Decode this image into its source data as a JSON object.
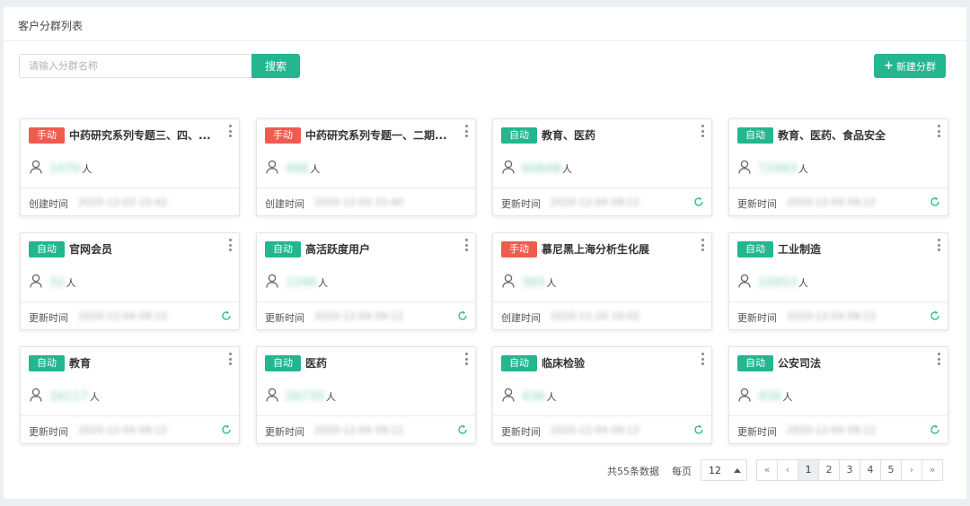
{
  "header": {
    "title": "客户分群列表"
  },
  "search": {
    "placeholder": "请输入分群名称",
    "button_label": "搜索"
  },
  "actions": {
    "new_label": "新建分群"
  },
  "cards": [
    {
      "badge": "手动",
      "badge_type": "manual",
      "title": "中药研究系列专题三、四、...",
      "count": "1070",
      "unit": "人",
      "time_label": "创建时间",
      "time_value": "2020-12-03 15:42",
      "refresh": false
    },
    {
      "badge": "手动",
      "badge_type": "manual",
      "title": "中药研究系列专题一、二期...",
      "count": "486",
      "unit": "人",
      "time_label": "创建时间",
      "time_value": "2020-12-03 15:40",
      "refresh": false
    },
    {
      "badge": "自动",
      "badge_type": "auto",
      "title": "教育、医药",
      "count": "60848",
      "unit": "人",
      "time_label": "更新时间",
      "time_value": "2020-12-04 09:12",
      "refresh": true
    },
    {
      "badge": "自动",
      "badge_type": "auto",
      "title": "教育、医药、食品安全",
      "count": "72063",
      "unit": "人",
      "time_label": "更新时间",
      "time_value": "2020-12-04 09:12",
      "refresh": true
    },
    {
      "badge": "自动",
      "badge_type": "auto",
      "title": "官网会员",
      "count": "32",
      "unit": "人",
      "time_label": "更新时间",
      "time_value": "2020-12-04 09:12",
      "refresh": true
    },
    {
      "badge": "自动",
      "badge_type": "auto",
      "title": "高活跃度用户",
      "count": "1246",
      "unit": "人",
      "time_label": "更新时间",
      "time_value": "2020-12-04 09:12",
      "refresh": true
    },
    {
      "badge": "手动",
      "badge_type": "manual",
      "title": "慕尼黑上海分析生化展",
      "count": "365",
      "unit": "人",
      "time_label": "创建时间",
      "time_value": "2020-11-20 10:02",
      "refresh": false
    },
    {
      "badge": "自动",
      "badge_type": "auto",
      "title": "工业制造",
      "count": "10953",
      "unit": "人",
      "time_label": "更新时间",
      "time_value": "2020-12-04 09:12",
      "refresh": true
    },
    {
      "badge": "自动",
      "badge_type": "auto",
      "title": "教育",
      "count": "34117",
      "unit": "人",
      "time_label": "更新时间",
      "time_value": "2020-12-04 09:12",
      "refresh": true
    },
    {
      "badge": "自动",
      "badge_type": "auto",
      "title": "医药",
      "count": "26735",
      "unit": "人",
      "time_label": "更新时间",
      "time_value": "2020-12-04 09:12",
      "refresh": true
    },
    {
      "badge": "自动",
      "badge_type": "auto",
      "title": "临床检验",
      "count": "436",
      "unit": "人",
      "time_label": "更新时间",
      "time_value": "2020-12-04 09:12",
      "refresh": true
    },
    {
      "badge": "自动",
      "badge_type": "auto",
      "title": "公安司法",
      "count": "456",
      "unit": "人",
      "time_label": "更新时间",
      "time_value": "2020-12-04 09:12",
      "refresh": true
    }
  ],
  "pagination": {
    "total_text": "共55条数据",
    "per_page_label": "每页",
    "per_page_value": "12",
    "first": "«",
    "prev": "‹",
    "pages": [
      "1",
      "2",
      "3",
      "4",
      "5"
    ],
    "current": "1",
    "next": "›",
    "last": "»"
  },
  "colors": {
    "accent": "#23b68f",
    "manual_badge": "#f05b4f"
  },
  "icons": {
    "user": "user-icon",
    "more": "more-vertical-icon",
    "refresh": "refresh-icon",
    "plus": "plus-icon"
  }
}
